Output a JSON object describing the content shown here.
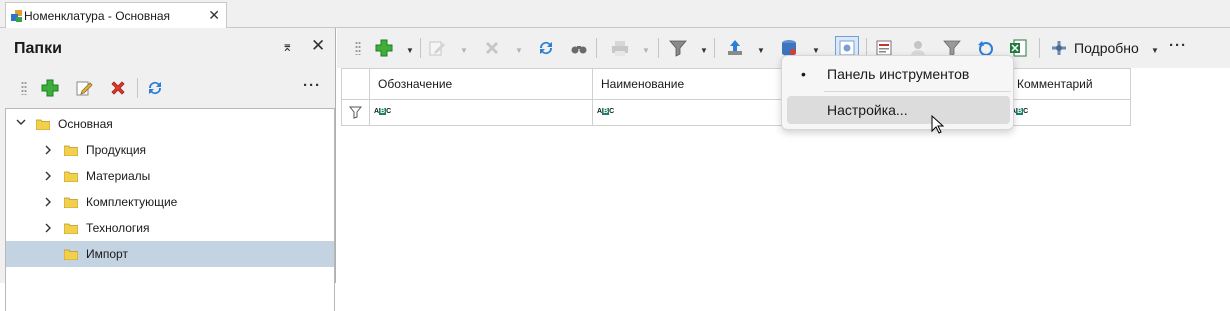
{
  "tab": {
    "title": "Номенклатура - Основная",
    "close": "✕"
  },
  "folders_panel": {
    "title": "Папки",
    "pin": "⌆",
    "close": "✕",
    "more": "···",
    "toolbar_icons": [
      "add-icon",
      "edit-icon",
      "delete-icon",
      "refresh-icon"
    ]
  },
  "tree": {
    "root": {
      "label": "Основная",
      "expanded": true
    },
    "children": [
      {
        "label": "Продукция"
      },
      {
        "label": "Материалы"
      },
      {
        "label": "Комплектующие"
      },
      {
        "label": "Технология"
      },
      {
        "label": "Импорт",
        "selected": true
      }
    ]
  },
  "main_toolbar": {
    "detail_label": "Подробно",
    "more": "···",
    "icons": [
      "add-icon",
      "edit-icon",
      "delete-icon",
      "refresh-icon",
      "binoculars-icon",
      "print-icon",
      "filter-icon",
      "export-icon",
      "database-icon",
      "settings-icon",
      "report-icon",
      "users-icon",
      "filter-clear-icon",
      "sync-icon",
      "excel-icon",
      "wrench-icon"
    ]
  },
  "grid": {
    "columns": [
      "Обозначение",
      "Наименование",
      "",
      "Комментарий"
    ]
  },
  "context_menu": {
    "items": [
      {
        "label": "Панель инструментов",
        "checked": true
      },
      {
        "label": "Настройка...",
        "hover": true
      }
    ]
  },
  "colors": {
    "selection": "#c4d3e1",
    "panel_bg": "#f0f0f0",
    "menu_hover": "#dcdcdc"
  }
}
